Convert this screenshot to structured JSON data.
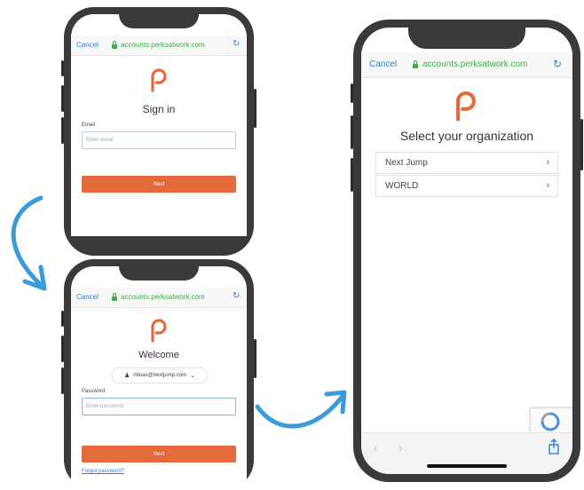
{
  "browser": {
    "cancel_label": "Cancel",
    "domain": "accounts.perksatwork.com"
  },
  "signin_screen": {
    "title": "Sign in",
    "email_label": "Email",
    "email_placeholder": "Enter email",
    "next_label": "Next"
  },
  "welcome_screen": {
    "title": "Welcome",
    "account_email": "nbuas@nextjump.com",
    "password_label": "Password",
    "password_placeholder": "Enter password",
    "next_label": "Next",
    "forgot_label": "Forgot password?"
  },
  "org_screen": {
    "title": "Select your organization",
    "organizations": [
      "Next Jump",
      "WORLD"
    ]
  },
  "icons": [
    "perks-logo-icon",
    "lock-icon",
    "reload-icon",
    "chevron-right-icon",
    "user-icon",
    "chevron-down-icon",
    "back-icon",
    "forward-icon",
    "share-icon",
    "recaptcha-icon",
    "flow-arrow-icon"
  ],
  "colors": {
    "brand_orange": "#e46a3b",
    "link_blue": "#2f7fd6",
    "secure_green": "#3fae49",
    "arrow_blue": "#3a9bd8"
  }
}
